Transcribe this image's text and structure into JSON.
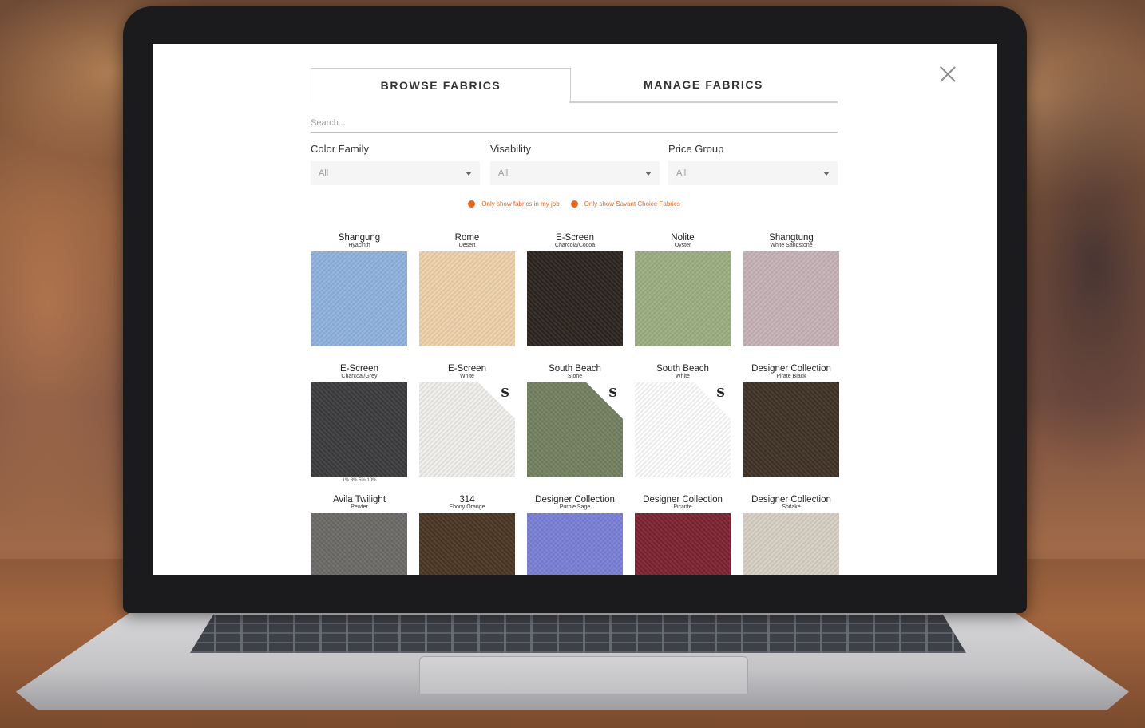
{
  "tabs": {
    "browse": "BROWSE FABRICS",
    "manage": "MANAGE FABRICS"
  },
  "search": {
    "placeholder": "Search..."
  },
  "filters": [
    {
      "label": "Color Family",
      "value": "All"
    },
    {
      "label": "Visability",
      "value": "All"
    },
    {
      "label": "Price Group",
      "value": "All"
    }
  ],
  "options": {
    "in_job": "Only show fabrics in my job",
    "savant": "Only show Savant Choice Fabrics"
  },
  "colors": {
    "accent": "#e8651e"
  },
  "fabrics": [
    {
      "name": "Shangung",
      "sub": "Hyacinth",
      "color": "#8fb3e0",
      "badge": ""
    },
    {
      "name": "Rome",
      "sub": "Desert",
      "color": "#efd2ab",
      "badge": ""
    },
    {
      "name": "E-Screen",
      "sub": "Charcola/Cocoa",
      "color": "#2b231d",
      "badge": ""
    },
    {
      "name": "Nolite",
      "sub": "Oyster",
      "color": "#9caf81",
      "badge": ""
    },
    {
      "name": "Shangtung",
      "sub": "White Sandstone",
      "color": "#c7b3b7",
      "badge": ""
    },
    {
      "name": "E-Screen",
      "sub": "Charcoal/Grey",
      "color": "#3b3b3d",
      "badge": "",
      "note": "1% 3% 5% 10%"
    },
    {
      "name": "E-Screen",
      "sub": "White",
      "color": "#f1f0ec",
      "badge": "S"
    },
    {
      "name": "South Beach",
      "sub": "Stone",
      "color": "#738060",
      "badge": "S"
    },
    {
      "name": "South Beach",
      "sub": "White",
      "color": "#ffffff",
      "badge": "S"
    },
    {
      "name": "Designer Collection",
      "sub": "Pirate Black",
      "color": "#3f3125",
      "badge": ""
    },
    {
      "name": "Avila Twilight",
      "sub": "Pewter",
      "color": "#6c6a67",
      "badge": ""
    },
    {
      "name": "314",
      "sub": "Ebony Orange",
      "color": "#4a3523",
      "badge": ""
    },
    {
      "name": "Designer Collection",
      "sub": "Purple Sage",
      "color": "#7a7fd8",
      "badge": ""
    },
    {
      "name": "Designer Collection",
      "sub": "Picante",
      "color": "#7d2230",
      "badge": ""
    },
    {
      "name": "Designer Collection",
      "sub": "Shitake",
      "color": "#d8d0c4",
      "badge": ""
    }
  ]
}
